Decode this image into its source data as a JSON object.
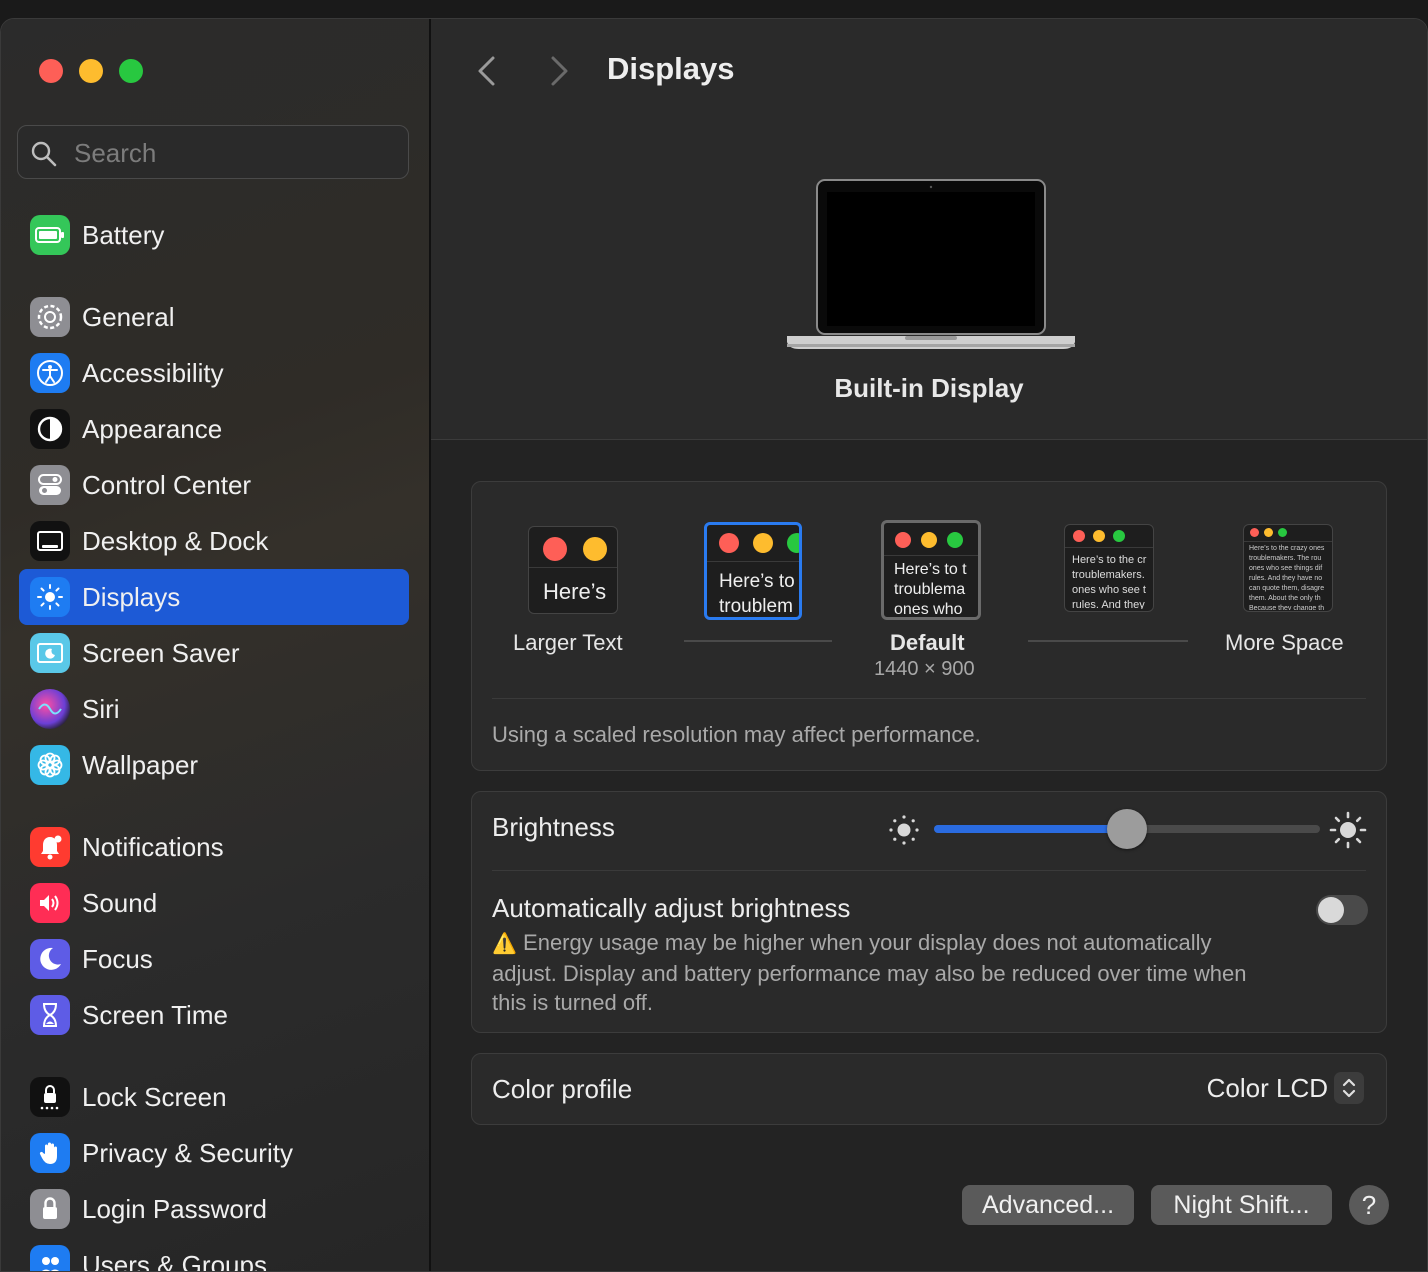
{
  "window": {
    "title": "Displays"
  },
  "search": {
    "placeholder": "Search"
  },
  "sidebar": {
    "items": [
      {
        "label": "Battery",
        "icon": "battery-icon",
        "color": "#34c759"
      },
      {
        "label": "General",
        "icon": "gear-icon",
        "color": "#8e8e93"
      },
      {
        "label": "Accessibility",
        "icon": "accessibility-icon",
        "color": "#1e7cf2"
      },
      {
        "label": "Appearance",
        "icon": "appearance-icon",
        "color": "#111111"
      },
      {
        "label": "Control Center",
        "icon": "control-center-icon",
        "color": "#8e8e93"
      },
      {
        "label": "Desktop & Dock",
        "icon": "desktop-dock-icon",
        "color": "#111111"
      },
      {
        "label": "Displays",
        "icon": "displays-icon",
        "color": "#1e7cf2"
      },
      {
        "label": "Screen Saver",
        "icon": "screen-saver-icon",
        "color": "#5ac8e8"
      },
      {
        "label": "Siri",
        "icon": "siri-icon",
        "color": "#6b3fd6"
      },
      {
        "label": "Wallpaper",
        "icon": "wallpaper-icon",
        "color": "#35b8e6"
      },
      {
        "label": "Notifications",
        "icon": "bell-icon",
        "color": "#ff3b30"
      },
      {
        "label": "Sound",
        "icon": "speaker-icon",
        "color": "#ff2d55"
      },
      {
        "label": "Focus",
        "icon": "moon-icon",
        "color": "#5e5ce6"
      },
      {
        "label": "Screen Time",
        "icon": "hourglass-icon",
        "color": "#5e5ce6"
      },
      {
        "label": "Lock Screen",
        "icon": "lock-screen-icon",
        "color": "#111111"
      },
      {
        "label": "Privacy & Security",
        "icon": "hand-icon",
        "color": "#1e7cf2"
      },
      {
        "label": "Login Password",
        "icon": "lock-icon",
        "color": "#8e8e93"
      },
      {
        "label": "Users & Groups",
        "icon": "users-icon",
        "color": "#1e7cf2"
      }
    ],
    "active_index": 6
  },
  "hero": {
    "display_name": "Built-in Display"
  },
  "resolution": {
    "options": [
      {
        "label": "Larger Text",
        "preview": "Here’s"
      },
      {
        "label": "",
        "preview": "Here’s to troublem"
      },
      {
        "label": "Default",
        "sub": "1440 × 900",
        "preview": "Here’s to t troublema ones who"
      },
      {
        "label": "",
        "preview": "Here’s to the cr troublemakers. ones who see t rules. And they"
      },
      {
        "label": "More Space",
        "preview": "Here’s to the crazy ones troublemakers. The rou ones who see things dif rules. And they have no can quote them, disagre them. About the only th Because they change th"
      }
    ],
    "selected_index": 1,
    "note": "Using a scaled resolution may affect performance."
  },
  "brightness": {
    "label": "Brightness",
    "value": 0.5
  },
  "auto_brightness": {
    "label": "Automatically adjust brightness",
    "enabled": false,
    "warning": "Energy usage may be higher when your display does not automatically adjust. Display and battery performance may also be reduced over time when this is turned off.",
    "warning_icon": "⚠️"
  },
  "color_profile": {
    "label": "Color profile",
    "value": "Color LCD"
  },
  "buttons": {
    "advanced": "Advanced...",
    "night_shift": "Night Shift...",
    "help": "?"
  },
  "colors": {
    "accent": "#1d5ad6",
    "slider_fill": "#2a6be0"
  }
}
